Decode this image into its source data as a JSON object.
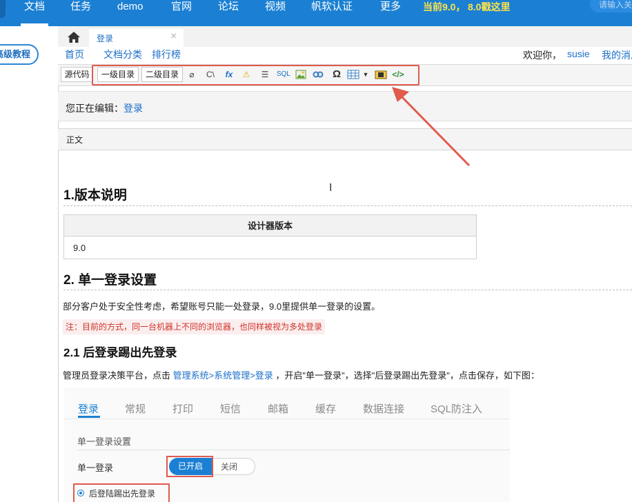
{
  "topnav": {
    "items": [
      "文档",
      "任务",
      "demo",
      "官网",
      "论坛",
      "视频",
      "帆软认证",
      "更多"
    ],
    "promo_text": "当前9.0，",
    "promo_link": "8.0戳这里",
    "search_placeholder": "请输入关"
  },
  "left_pill": "高级教程",
  "tab": {
    "label": "登录",
    "close": "×"
  },
  "subnav": {
    "home": "首页",
    "categories": "文档分类",
    "ranking": "排行榜"
  },
  "user": {
    "welcome": "欢迎你，",
    "name": "susie",
    "my_messages": "我的消息"
  },
  "toolbar": {
    "source": "源代码",
    "toc1": "一级目录",
    "toc2": "二级目录",
    "icons": [
      "eraser-icon",
      "code-icon",
      "formula-icon",
      "warning-icon",
      "list-icon",
      "sql-icon",
      "image-icon",
      "link-icon",
      "omega-icon",
      "table-icon",
      "dropdown-icon",
      "video-icon",
      "html-icon"
    ]
  },
  "editing": {
    "label": "您正在编辑：",
    "title": "登录"
  },
  "body_label": "正文",
  "content": {
    "h_version": "1.版本说明",
    "table_header": "设计器版本",
    "table_value": "9.0",
    "h_single": "2. 单一登录设置",
    "p_single": "部分客户处于安全性考虑，希望账号只能一处登录，9.0里提供单一登录的设置。",
    "note": "注：目前的方式，同一台机器上不同的浏览器，也同样被视为多处登录",
    "h_sub": "2.1 后登录踢出先登录",
    "p_admin_pre": "管理员登录决策平台，点击 ",
    "p_admin_link": "管理系统>系统管理>登录",
    "p_admin_post": " ，开启\"单一登录\"，选择\"后登录踢出先登录\"，点击保存，如下图："
  },
  "screenshot": {
    "tabs": [
      "登录",
      "常规",
      "打印",
      "短信",
      "邮箱",
      "缓存",
      "数据连接",
      "SQL防注入"
    ],
    "section": "单一登录设置",
    "row_label": "单一登录",
    "toggle_on": "已开启",
    "toggle_off": "关闭",
    "radio_label": "后登陆踢出先登录"
  },
  "colors": {
    "nav": "#1b80d3",
    "link": "#1a6fc7",
    "highlight": "#e05a4d",
    "note_text": "#d0332b"
  }
}
